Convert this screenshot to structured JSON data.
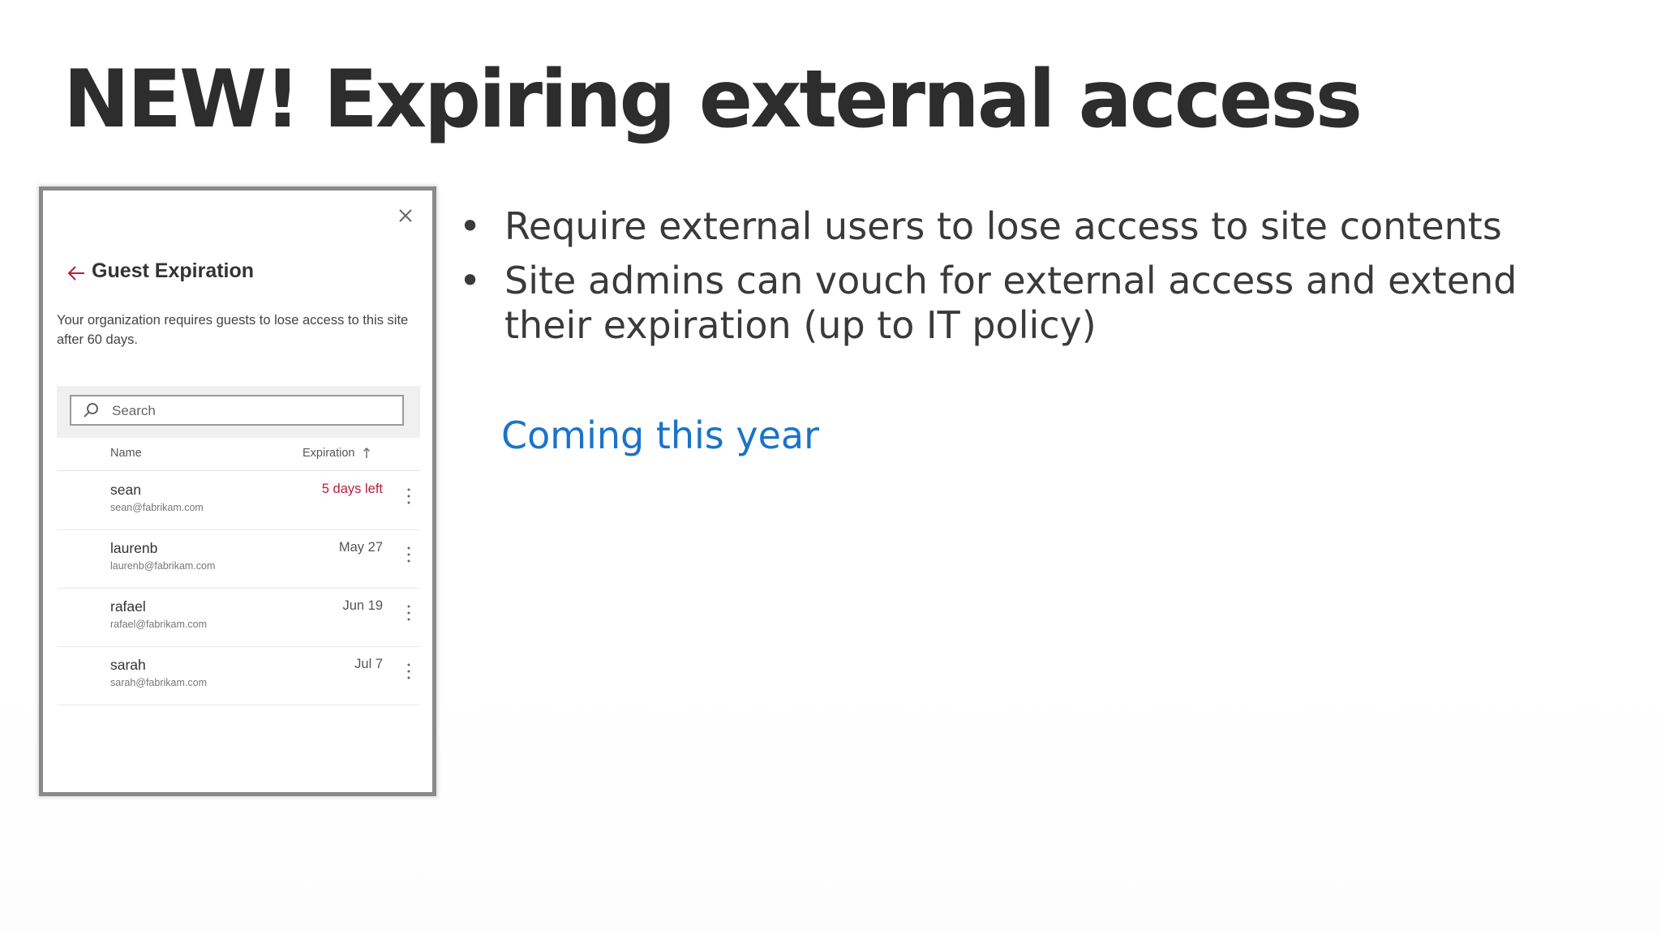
{
  "slide": {
    "title": "NEW! Expiring external access",
    "bullets": [
      "Require external users to lose access to site contents",
      "Site admins can vouch for external access and extend their expiration (up to IT policy)"
    ],
    "bullet_symbol": "•",
    "coming": "Coming this year",
    "accent_color": "#1a73c9"
  },
  "panel": {
    "title": "Guest Expiration",
    "description": "Your organization requires guests to lose access to this site after 60 days.",
    "search_placeholder": "Search",
    "columns": {
      "name": "Name",
      "expiration": "Expiration"
    },
    "icons": [
      "close-icon",
      "back-arrow-icon",
      "search-icon",
      "sort-ascending-icon",
      "more-options-icon"
    ],
    "warning_color": "#b4203a",
    "guests": [
      {
        "name": "sean",
        "email": "sean@fabrikam.com",
        "expiration": "5 days left",
        "warning": true
      },
      {
        "name": "laurenb",
        "email": "laurenb@fabrikam.com",
        "expiration": "May 27",
        "warning": false
      },
      {
        "name": "rafael",
        "email": "rafael@fabrikam.com",
        "expiration": "Jun 19",
        "warning": false
      },
      {
        "name": "sarah",
        "email": "sarah@fabrikam.com",
        "expiration": "Jul 7",
        "warning": false
      }
    ]
  }
}
